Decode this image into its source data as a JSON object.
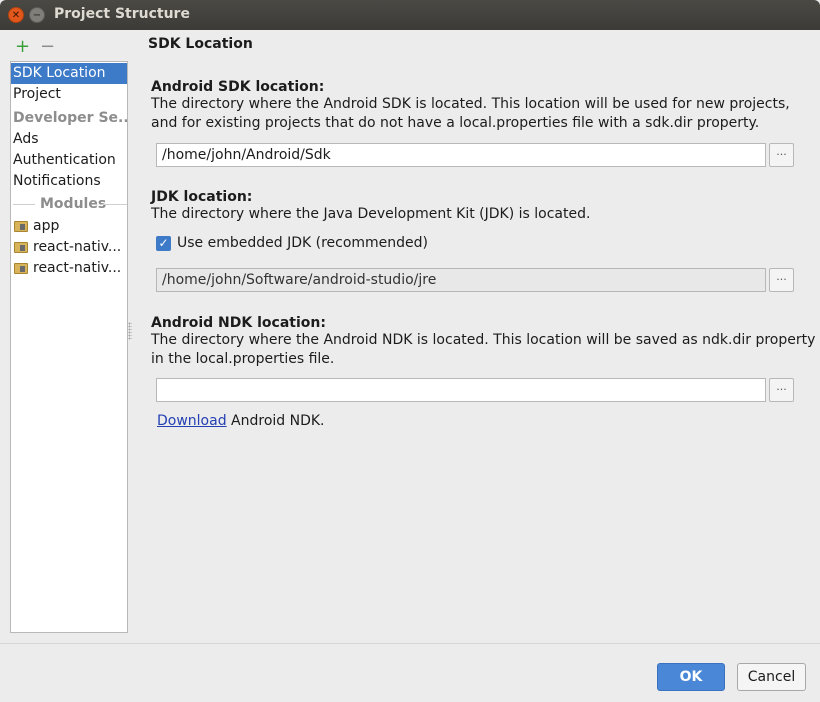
{
  "window": {
    "title": "Project Structure"
  },
  "sidebar": {
    "add_icon": "+",
    "remove_icon": "−",
    "items": [
      {
        "label": "SDK Location",
        "selected": true
      },
      {
        "label": "Project"
      }
    ],
    "developer_header": "Developer Se...",
    "developer_items": [
      "Ads",
      "Authentication",
      "Notifications"
    ],
    "modules_header": "Modules",
    "modules": [
      "app",
      "react-nativ...",
      "react-nativ..."
    ]
  },
  "content": {
    "section_title": "SDK Location",
    "sdk": {
      "heading": "Android SDK location:",
      "description_line1": "The directory where the Android SDK is located. This location will be used for new projects,",
      "description_line2": "and for existing projects that do not have a local.properties file with a sdk.dir property.",
      "path": "/home/john/Android/Sdk",
      "browse_label": "..."
    },
    "jdk": {
      "heading": "JDK location:",
      "description": "The directory where the Java Development Kit (JDK) is located.",
      "checkbox_label": "Use embedded JDK (recommended)",
      "checkbox_checked": true,
      "path": "/home/john/Software/android-studio/jre",
      "browse_label": "..."
    },
    "ndk": {
      "heading": "Android NDK location:",
      "description_line1": "The directory where the Android NDK is located. This location will be saved as ndk.dir property",
      "description_line2": "in the local.properties file.",
      "path": "",
      "browse_label": "...",
      "download_link": "Download",
      "download_suffix": " Android NDK."
    }
  },
  "footer": {
    "ok_label": "OK",
    "cancel_label": "Cancel"
  },
  "colors": {
    "accent": "#3d7ac8",
    "ok_button": "#4a87d6",
    "link": "#2440b3",
    "titlebar": "#3c3b37"
  }
}
